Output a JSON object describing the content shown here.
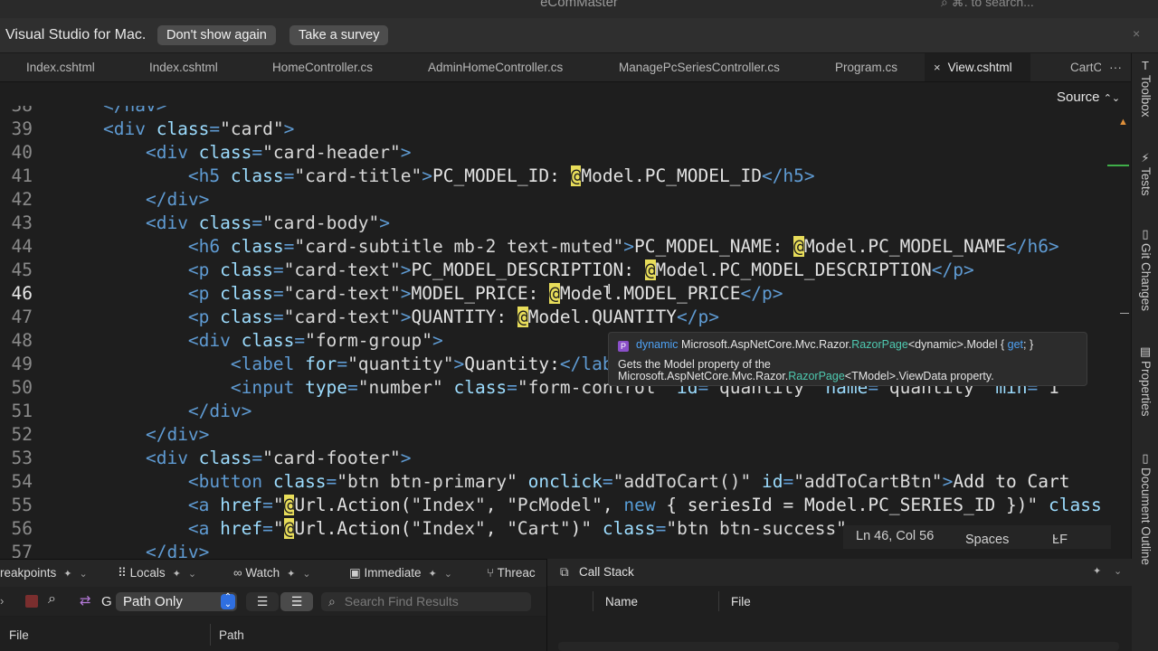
{
  "window": {
    "title": "eComMaster",
    "search_placeholder": "⌘. to search..."
  },
  "infobar": {
    "message": "Visual Studio for Mac.",
    "dont_show_label": "Don't show again",
    "survey_label": "Take a survey",
    "close_glyph": "×"
  },
  "tabs": [
    {
      "label": "Index.cshtml",
      "active": false
    },
    {
      "label": "Index.cshtml",
      "active": false
    },
    {
      "label": "HomeController.cs",
      "active": false
    },
    {
      "label": "AdminHomeController.cs",
      "active": false
    },
    {
      "label": "ManagePcSeriesController.cs",
      "active": false
    },
    {
      "label": "Program.cs",
      "active": false
    },
    {
      "label": "View.cshtml",
      "active": true
    },
    {
      "label": "CartC",
      "active": false
    }
  ],
  "tab_close_glyph": "×",
  "tabs_more_glyph": "···",
  "source": {
    "label": "Source",
    "chevron": "⌃⌄"
  },
  "editor": {
    "lines": [
      {
        "n": "38",
        "current": false,
        "html": "<span class='t'>&lt;/nav&gt;</span>"
      },
      {
        "n": "39",
        "current": false,
        "html": "<span class='t'>&lt;div </span><span class='a'>class</span><span class='t'>=</span><span class='s'>\"card\"</span><span class='t'>&gt;</span>"
      },
      {
        "n": "40",
        "current": false,
        "html": "    <span class='t'>&lt;div </span><span class='a'>class</span><span class='t'>=</span><span class='s'>\"card-header\"</span><span class='t'>&gt;</span>"
      },
      {
        "n": "41",
        "current": false,
        "html": "        <span class='t'>&lt;h5 </span><span class='a'>class</span><span class='t'>=</span><span class='s'>\"card-title\"</span><span class='t'>&gt;</span><span class='x'>PC_MODEL_ID: </span><span class='at'>@</span><span class='x'>Model.PC_MODEL_ID</span><span class='t'>&lt;/h5&gt;</span>"
      },
      {
        "n": "42",
        "current": false,
        "html": "    <span class='t'>&lt;/div&gt;</span>"
      },
      {
        "n": "43",
        "current": false,
        "html": "    <span class='t'>&lt;div </span><span class='a'>class</span><span class='t'>=</span><span class='s'>\"card-body\"</span><span class='t'>&gt;</span>"
      },
      {
        "n": "44",
        "current": false,
        "html": "        <span class='t'>&lt;h6 </span><span class='a'>class</span><span class='t'>=</span><span class='s'>\"card-subtitle mb-2 text-muted\"</span><span class='t'>&gt;</span><span class='x'>PC_MODEL_NAME: </span><span class='at'>@</span><span class='x'>Model.PC_MODEL_NAME</span><span class='t'>&lt;/h6&gt;</span>"
      },
      {
        "n": "45",
        "current": false,
        "html": "        <span class='t'>&lt;p </span><span class='a'>class</span><span class='t'>=</span><span class='s'>\"card-text\"</span><span class='t'>&gt;</span><span class='x'>PC_MODEL_DESCRIPTION: </span><span class='at'>@</span><span class='x'>Model.PC_MODEL_DESCRIPTION</span><span class='t'>&lt;/p&gt;</span>"
      },
      {
        "n": "46",
        "current": true,
        "html": "        <span class='t'>&lt;p </span><span class='a'>class</span><span class='t'>=</span><span class='s'>\"card-text\"</span><span class='t'>&gt;</span><span class='x'>MODEL_PRICE: </span><span class='at'>@</span><span class='x'>Model.MODEL_PRICE</span><span class='t'>&lt;/p&gt;</span>"
      },
      {
        "n": "47",
        "current": false,
        "html": "        <span class='t'>&lt;p </span><span class='a'>class</span><span class='t'>=</span><span class='s'>\"card-text\"</span><span class='t'>&gt;</span><span class='x'>QUANTITY: </span><span class='at'>@</span><span class='x'>Model.QUANTITY</span><span class='t'>&lt;/p&gt;</span>"
      },
      {
        "n": "48",
        "current": false,
        "html": "        <span class='t'>&lt;div </span><span class='a'>class</span><span class='t'>=</span><span class='s'>\"form-group\"</span><span class='t'>&gt;</span>"
      },
      {
        "n": "49",
        "current": false,
        "html": "            <span class='t'>&lt;label </span><span class='a'>for</span><span class='t'>=</span><span class='s'>\"quantity\"</span><span class='t'>&gt;</span><span class='x'>Quantity:</span><span class='t'>&lt;/label&gt;</span>"
      },
      {
        "n": "50",
        "current": false,
        "html": "            <span class='t'>&lt;input </span><span class='a'>type</span><span class='t'>=</span><span class='s'>\"number\"</span> <span class='a'>class</span><span class='t'>=</span><span class='s'>\"form-control\"</span> <span class='a'>id</span><span class='t'>=</span><span class='s'>\"quantity\"</span> <span class='a'>name</span><span class='t'>=</span><span class='s'>\"quantity\"</span> <span class='a'>min</span><span class='t'>=</span><span class='s'>\"1\"</span>"
      },
      {
        "n": "51",
        "current": false,
        "html": "        <span class='t'>&lt;/div&gt;</span>"
      },
      {
        "n": "52",
        "current": false,
        "html": "    <span class='t'>&lt;/div&gt;</span>"
      },
      {
        "n": "53",
        "current": false,
        "html": "    <span class='t'>&lt;div </span><span class='a'>class</span><span class='t'>=</span><span class='s'>\"card-footer\"</span><span class='t'>&gt;</span>"
      },
      {
        "n": "54",
        "current": false,
        "html": "        <span class='t'>&lt;button </span><span class='a'>class</span><span class='t'>=</span><span class='s'>\"btn btn-primary\"</span> <span class='a'>onclick</span><span class='t'>=</span><span class='s'>\"addToCart()\"</span> <span class='a'>id</span><span class='t'>=</span><span class='s'>\"addToCartBtn\"</span><span class='t'>&gt;</span><span class='x'>Add to Cart</span>"
      },
      {
        "n": "55",
        "current": false,
        "html": "        <span class='t'>&lt;a </span><span class='a'>href</span><span class='t'>=</span><span class='s'>\"</span><span class='at'>@</span><span class='x'>Url.Action(</span><span class='s'>\"Index\"</span><span class='x'>, </span><span class='s'>\"PcModel\"</span><span class='x'>, </span><span class='k'>new</span><span class='x'> { seriesId = Model.PC_SERIES_ID })</span><span class='s'>\"</span> <span class='a'>class</span>"
      },
      {
        "n": "56",
        "current": false,
        "html": "        <span class='t'>&lt;a </span><span class='a'>href</span><span class='t'>=</span><span class='s'>\"</span><span class='at'>@</span><span class='x'>Url.Action(</span><span class='s'>\"Index\"</span><span class='x'>, </span><span class='s'>\"Cart\"</span><span class='x'>)</span><span class='s'>\"</span> <span class='a'>class</span><span class='t'>=</span><span class='s'>\"btn btn-success\"</span>"
      },
      {
        "n": "57",
        "current": false,
        "html": "    <span class='t'>&lt;/div&gt;</span>"
      }
    ]
  },
  "tooltip": {
    "badge": "P",
    "sig_dynamic": "dynamic",
    "sig_ns": "Microsoft.AspNetCore.Mvc.Razor.",
    "sig_type": "RazorPage",
    "sig_generic": "<dynamic>",
    "sig_member": ".Model { ",
    "sig_get": "get",
    "sig_end": "; }",
    "doc_line1": "Gets the Model property of the",
    "doc_ns": "Microsoft.AspNetCore.Mvc.Razor.",
    "doc_type": "RazorPage",
    "doc_generic": "<TModel>",
    "doc_tail": ".ViewData property."
  },
  "status": {
    "position": "Ln 46, Col 56",
    "indent": "Spaces",
    "line_ending": "LF"
  },
  "right_strip": [
    {
      "label": "Toolbox",
      "icon": "toolbox-icon"
    },
    {
      "label": "Tests",
      "icon": "tests-icon"
    },
    {
      "label": "Git Changes",
      "icon": "git-changes-icon"
    },
    {
      "label": "Properties",
      "icon": "properties-icon"
    },
    {
      "label": "Document Outline",
      "icon": "document-outline-icon"
    }
  ],
  "bottom_tabs": [
    {
      "label": "reakpoints"
    },
    {
      "label": "Locals"
    },
    {
      "label": "Watch"
    },
    {
      "label": "Immediate"
    },
    {
      "label": "Threac"
    }
  ],
  "find": {
    "g_label": "G",
    "scope_value": "Path Only",
    "search_placeholder": "Search Find Results"
  },
  "results_columns": [
    "File",
    "Path"
  ],
  "callstack": {
    "title": "Call Stack",
    "columns": [
      "Name",
      "File"
    ]
  }
}
